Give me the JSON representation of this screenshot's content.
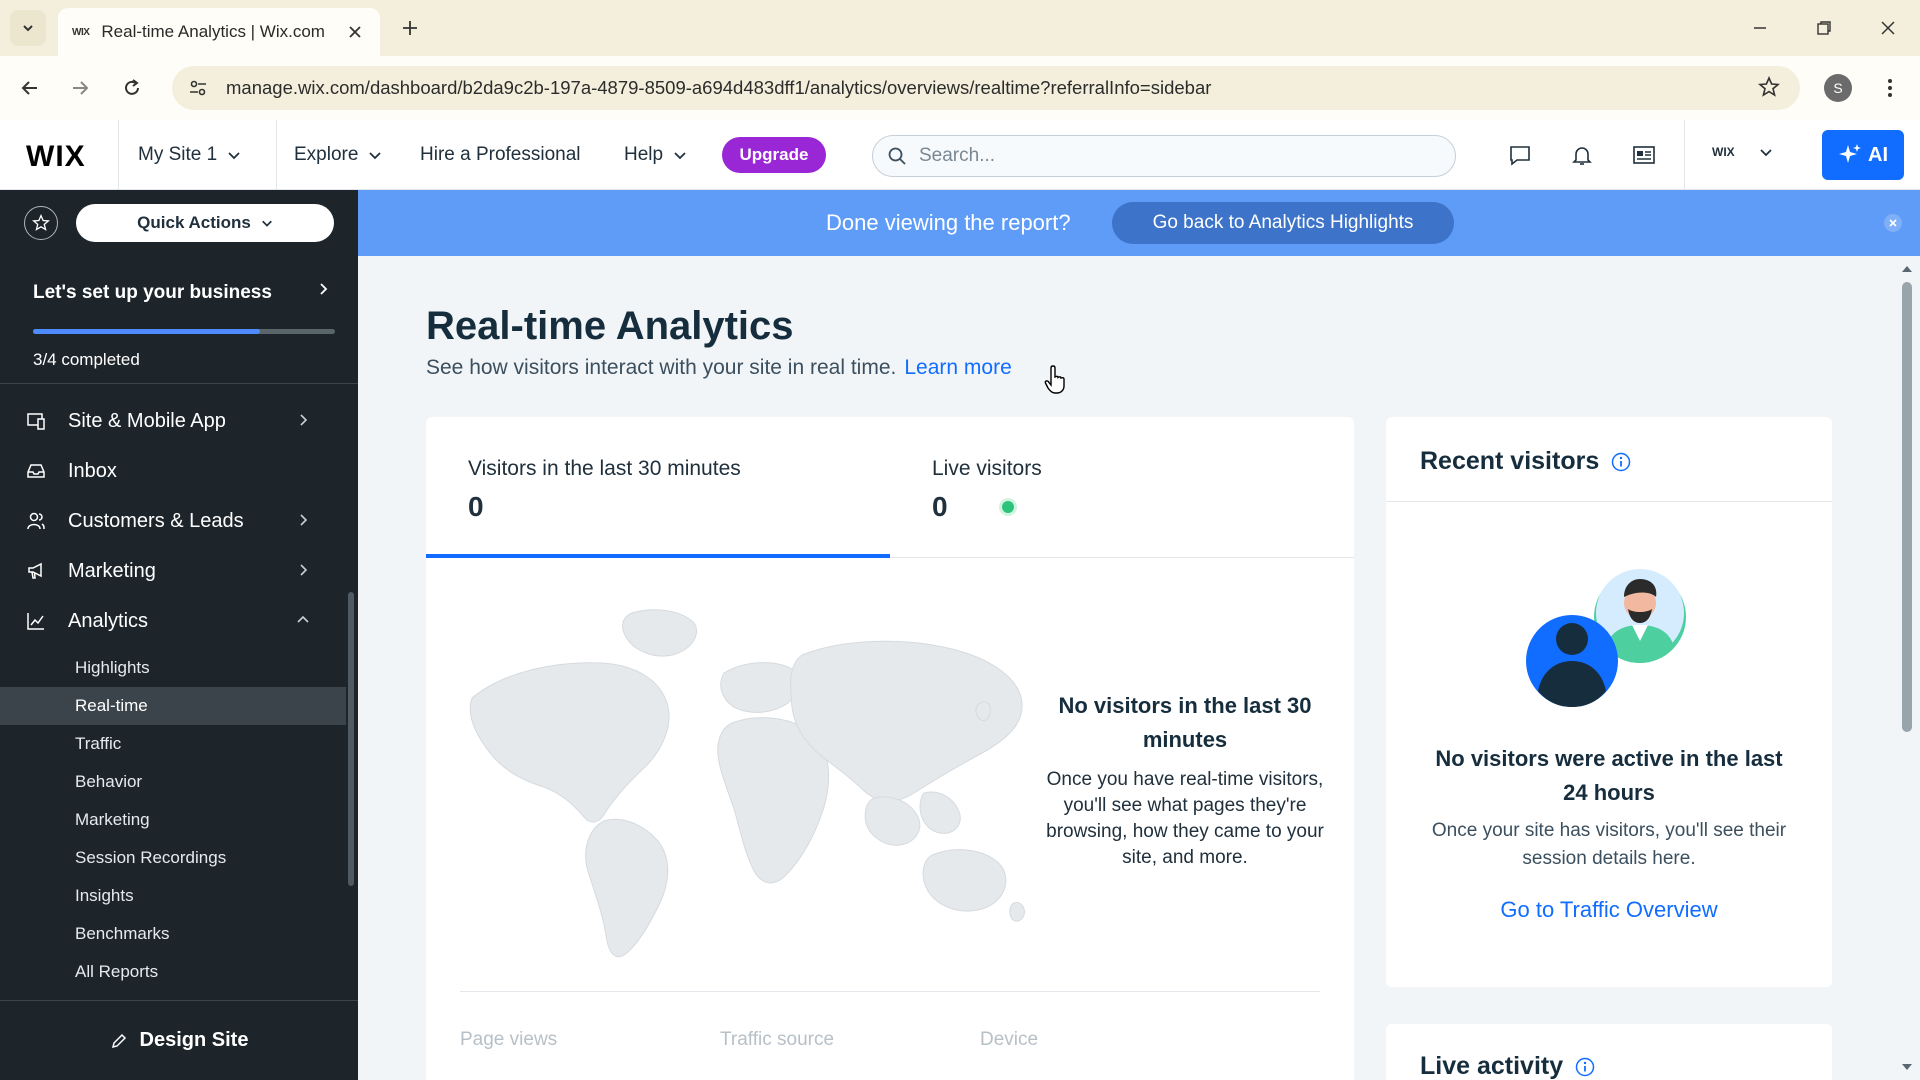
{
  "browser": {
    "tab_title": "Real-time Analytics | Wix.com",
    "tab_favicon": "WIX",
    "url": "manage.wix.com/dashboard/b2da9c2b-197a-4879-8509-a694d483dff1/analytics/overviews/realtime?referralInfo=sidebar",
    "profile_initial": "S"
  },
  "topbar": {
    "logo": "WIX",
    "site_selector": "My Site 1",
    "explore": "Explore",
    "hire": "Hire a Professional",
    "help": "Help",
    "upgrade": "Upgrade",
    "search_placeholder": "Search...",
    "account_label": "WIX",
    "ai_label": "AI"
  },
  "sidebar": {
    "quick_actions": "Quick Actions",
    "setup_title": "Let's set up your business",
    "setup_progress_fraction": 0.75,
    "setup_count": "3/4 completed",
    "items": [
      {
        "label": "Site & Mobile App",
        "icon": "site-icon",
        "has_arrow": true
      },
      {
        "label": "Inbox",
        "icon": "inbox-icon",
        "has_arrow": false
      },
      {
        "label": "Customers & Leads",
        "icon": "customers-icon",
        "has_arrow": true
      },
      {
        "label": "Marketing",
        "icon": "megaphone-icon",
        "has_arrow": true
      },
      {
        "label": "Analytics",
        "icon": "analytics-icon",
        "has_arrow": true
      }
    ],
    "analytics_sub": [
      "Highlights",
      "Real-time",
      "Traffic",
      "Behavior",
      "Marketing",
      "Session Recordings",
      "Insights",
      "Benchmarks",
      "All Reports"
    ],
    "active_sub": "Real-time",
    "design_site": "Design Site"
  },
  "banner": {
    "text": "Done viewing the report?",
    "button": "Go back to Analytics Highlights"
  },
  "main": {
    "title": "Real-time Analytics",
    "subtitle": "See how visitors interact with your site in real time.",
    "learn_more": "Learn more",
    "metrics": {
      "last30_label": "Visitors in the last 30 minutes",
      "last30_value": "0",
      "live_label": "Live visitors",
      "live_value": "0"
    },
    "empty_title": "No visitors in the last 30 minutes",
    "empty_text": "Once you have real-time visitors, you'll see what pages they're browsing, how they came to your site, and more.",
    "bottom_tabs": [
      "Page views",
      "Traffic source",
      "Device"
    ],
    "recent": {
      "title": "Recent visitors",
      "empty_title": "No visitors were active in the last 24 hours",
      "empty_text": "Once your site has visitors, you'll see their session details here.",
      "link": "Go to Traffic Overview"
    },
    "live_activity_title": "Live activity"
  },
  "colors": {
    "accent": "#116dff",
    "upgrade": "#9a27d5",
    "sidebar_bg": "#1d252b",
    "banner_bg": "#5e9cf7",
    "live_dot": "#2cc37a"
  }
}
